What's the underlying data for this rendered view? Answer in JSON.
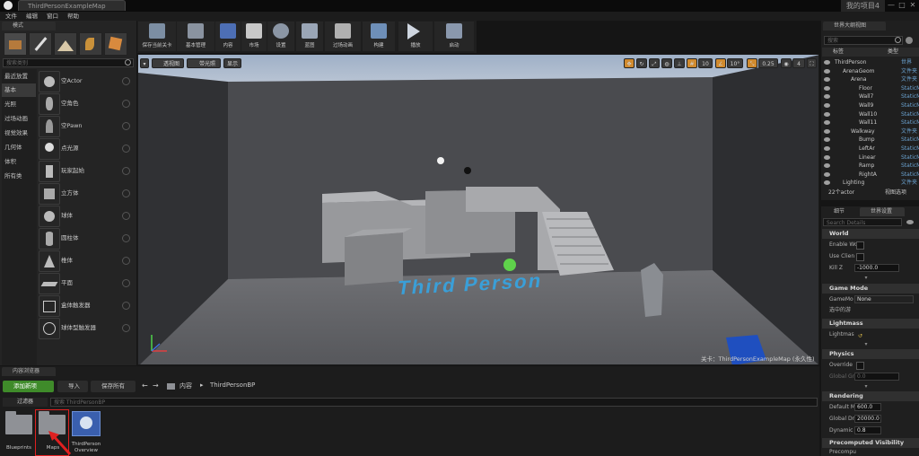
{
  "window": {
    "tab_title": "ThirdPersonExampleMap",
    "project_name": "我的项目4"
  },
  "menu": [
    "文件",
    "编辑",
    "窗口",
    "帮助"
  ],
  "modes_panel": {
    "tab": "模式",
    "search_placeholder": "搜索类别",
    "categories": [
      "最近放置",
      "基本",
      "光照",
      "过场动画",
      "视觉效果",
      "几何体",
      "体积",
      "所有类"
    ],
    "selected_category": "基本",
    "items": [
      "空Actor",
      "空角色",
      "空Pawn",
      "点光源",
      "玩家起始",
      "立方体",
      "球体",
      "圆柱体",
      "椎体",
      "平面",
      "盒体触发器",
      "球体型触发器"
    ]
  },
  "toolbar": {
    "buttons": [
      "保存当前关卡",
      "基本管理",
      "内容",
      "市场",
      "设置",
      "蓝图",
      "过场动画",
      "构建",
      "播放",
      "启动"
    ]
  },
  "viewport": {
    "view_mode_buttons": [
      "透视图",
      "带光照",
      "显示"
    ],
    "grid_snap": "10",
    "rotation_snap": "10°",
    "scale_snap": "0.25",
    "camera_speed": "4",
    "text_in_scene": "Third Person",
    "level_label": "关卡：ThirdPersonExampleMap (永久性)"
  },
  "world_outliner": {
    "tab": "世界大纲视图",
    "search_placeholder": "搜索",
    "col_label": "标签",
    "col_type": "类型",
    "rows": [
      {
        "name": "ThirdPerson",
        "type": "世界",
        "depth": 0
      },
      {
        "name": "ArenaGeom",
        "type": "文件夹",
        "depth": 1
      },
      {
        "name": "Arena",
        "type": "文件夹",
        "depth": 2
      },
      {
        "name": "Floor",
        "type": "StaticMe",
        "depth": 3
      },
      {
        "name": "Wall7",
        "type": "StaticMe",
        "depth": 3
      },
      {
        "name": "Wall9",
        "type": "StaticMe",
        "depth": 3
      },
      {
        "name": "Wall10",
        "type": "StaticMe",
        "depth": 3
      },
      {
        "name": "Wall11",
        "type": "StaticMe",
        "depth": 3
      },
      {
        "name": "Walkway",
        "type": "文件夹",
        "depth": 2
      },
      {
        "name": "Bump",
        "type": "StaticMe",
        "depth": 3
      },
      {
        "name": "LeftAr",
        "type": "StaticMe",
        "depth": 3
      },
      {
        "name": "Linear",
        "type": "StaticMe",
        "depth": 3
      },
      {
        "name": "Ramp",
        "type": "StaticMe",
        "depth": 3
      },
      {
        "name": "RightA",
        "type": "StaticMe",
        "depth": 3
      },
      {
        "name": "Lighting",
        "type": "文件夹",
        "depth": 1
      }
    ],
    "actor_count": "22个actor",
    "view_options": "视图选项"
  },
  "details": {
    "tab_details": "细节",
    "tab_world_settings": "世界设置",
    "search_placeholder": "Search Details",
    "sections": {
      "world": "World",
      "game_mode": "Game Mode",
      "lightmass": "Lightmass",
      "physics": "Physics",
      "rendering": "Rendering",
      "precomputed": "Precomputed Visibility"
    },
    "props": {
      "enable_world": "Enable Wo",
      "use_client": "Use Clien",
      "kill_z": "Kill Z",
      "kill_z_value": "-1000.0",
      "game_mode": "GameMo",
      "game_mode_value": "None",
      "selected": "选中的游",
      "lightmass": "Lightmas",
      "override": "Override",
      "global_gr": "Global Gr",
      "global_gr_value": "0.0",
      "default_m": "Default M",
      "default_m_value": "600.0",
      "global_dr": "Global Dr",
      "global_dr_value": "20000.0",
      "dynamic": "Dynamic",
      "dynamic_value": "0.8",
      "precomputed": "Precompu"
    }
  },
  "content_browser": {
    "tab": "内容浏览器",
    "add_new": "添加新项",
    "import": "导入",
    "save_all": "保存所有",
    "path_root": "内容",
    "path_folder": "ThirdPersonBP",
    "filters": "过滤器",
    "search_placeholder": "搜索 ThirdPersonBP",
    "assets": [
      "Blueprints",
      "Maps",
      "ThirdPerson Overview"
    ]
  },
  "colors": {
    "accent_green": "#3f8b2a",
    "annotation_red": "#e02020",
    "scene_text": "#3a9fd8"
  }
}
